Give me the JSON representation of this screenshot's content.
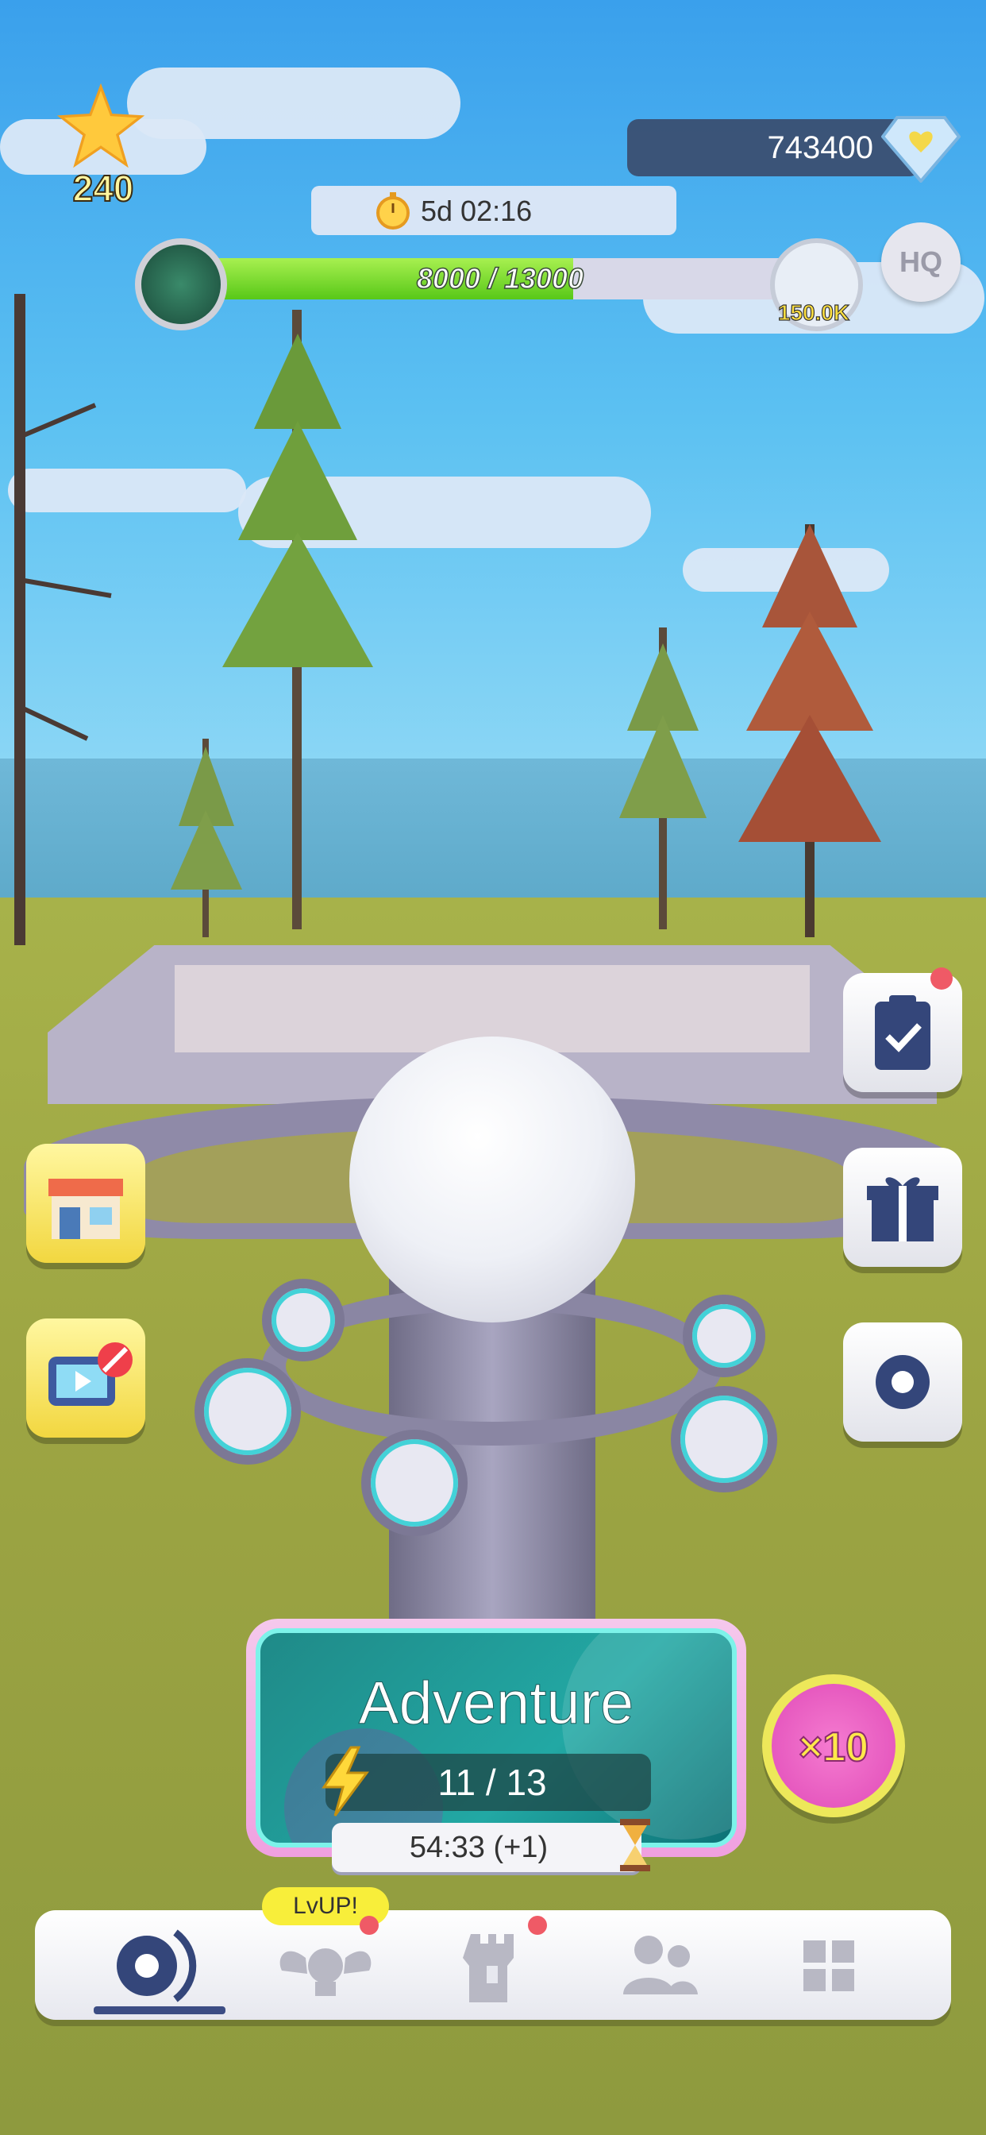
{
  "hud": {
    "stars": "240",
    "gems": "743400",
    "event_timer": "5d 02:16",
    "hq_label": "HQ",
    "xp_text": "8000 / 13000",
    "xp_progress": 0.615,
    "reward_amount": "150.0K"
  },
  "left_buttons": [
    {
      "icon": "shop-icon"
    },
    {
      "icon": "tv-no-ads-icon"
    }
  ],
  "right_buttons": [
    {
      "icon": "clipboard-check-icon",
      "notification": true
    },
    {
      "icon": "gift-icon"
    },
    {
      "icon": "target-icon"
    }
  ],
  "adventure": {
    "title": "Adventure",
    "energy": "11 / 13",
    "regen_timer": "54:33 (+1)",
    "multiplier": "×10"
  },
  "nav": {
    "lvup_badge": "LvUP!",
    "items": [
      {
        "icon": "cannon-icon",
        "active": true
      },
      {
        "icon": "winged-emblem-icon",
        "notification": true
      },
      {
        "icon": "castle-tower-icon",
        "notification": true
      },
      {
        "icon": "friends-icon"
      },
      {
        "icon": "grid-menu-icon"
      }
    ]
  },
  "colors": {
    "sky": "#3aa0ec",
    "ground": "#9da543",
    "adventure_teal": "#1f8a88",
    "accent_pink": "#f0a0e0",
    "nav_active": "#3c4d84",
    "notification_red": "#ef5a66"
  }
}
